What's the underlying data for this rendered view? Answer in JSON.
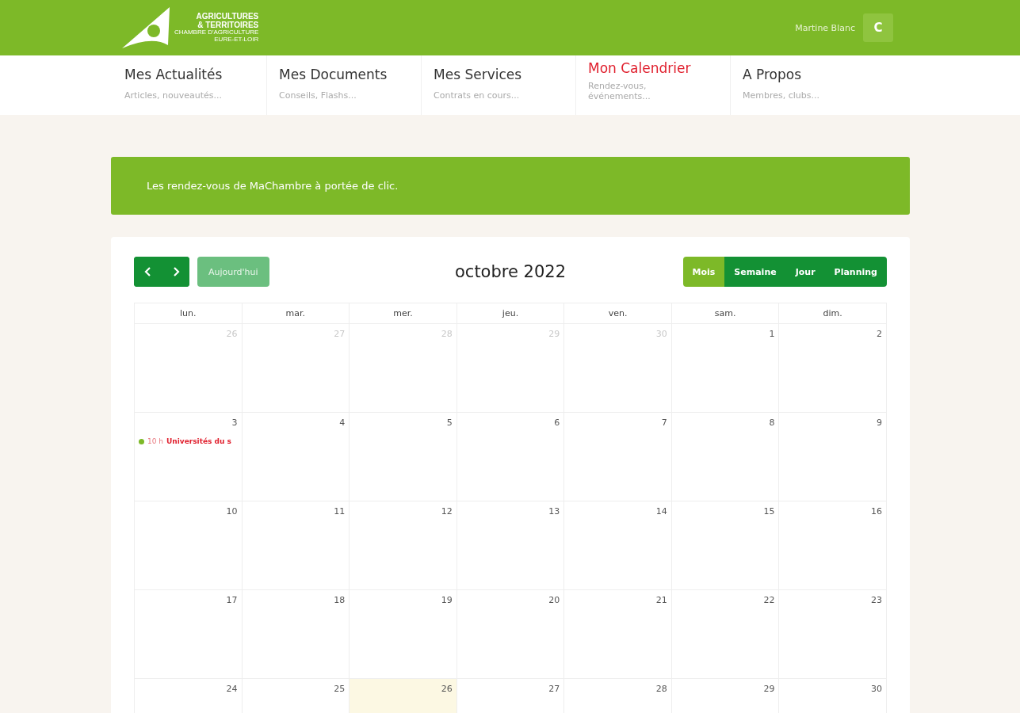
{
  "header": {
    "logo": {
      "line_1": "AGRICULTURES",
      "line_2": "& TERRITOIRES",
      "line_3": "CHAMBRE D'AGRICULTURE",
      "line_4": "EURE-ET-LOIR"
    },
    "user_name": "Martine Blanc",
    "avatar_initial": "C"
  },
  "nav": [
    {
      "title": "Mes Actualités",
      "subtitle": "Articles, nouveautés...",
      "selected": false
    },
    {
      "title": "Mes Documents",
      "subtitle": "Conseils, Flashs...",
      "selected": false
    },
    {
      "title": "Mes Services",
      "subtitle": "Contrats en cours...",
      "selected": false
    },
    {
      "title": "Mon Calendrier",
      "subtitle": "Rendez-vous, événements...",
      "selected": true
    },
    {
      "title": "A Propos",
      "subtitle": "Membres, clubs...",
      "selected": false
    }
  ],
  "banner": "Les rendez-vous de MaChambre à portée de clic.",
  "calendar": {
    "title": "octobre 2022",
    "today_button": {
      "label": "Aujourd'hui",
      "disabled": true
    },
    "views": [
      {
        "label": "Mois",
        "selected": true
      },
      {
        "label": "Semaine",
        "selected": false
      },
      {
        "label": "Jour",
        "selected": false
      },
      {
        "label": "Planning",
        "selected": false
      }
    ],
    "weekdays": [
      "lun.",
      "mar.",
      "mer.",
      "jeu.",
      "ven.",
      "sam.",
      "dim."
    ],
    "weeks": [
      [
        {
          "day": "26",
          "outside": true,
          "today": false
        },
        {
          "day": "27",
          "outside": true,
          "today": false
        },
        {
          "day": "28",
          "outside": true,
          "today": false
        },
        {
          "day": "29",
          "outside": true,
          "today": false
        },
        {
          "day": "30",
          "outside": true,
          "today": false
        },
        {
          "day": "1",
          "outside": false,
          "today": false
        },
        {
          "day": "2",
          "outside": false,
          "today": false
        }
      ],
      [
        {
          "day": "3",
          "outside": false,
          "today": false,
          "events": [
            {
              "time": "10 h",
              "title": "Universités du s",
              "color": "#7db928"
            }
          ]
        },
        {
          "day": "4",
          "outside": false,
          "today": false
        },
        {
          "day": "5",
          "outside": false,
          "today": false
        },
        {
          "day": "6",
          "outside": false,
          "today": false
        },
        {
          "day": "7",
          "outside": false,
          "today": false
        },
        {
          "day": "8",
          "outside": false,
          "today": false
        },
        {
          "day": "9",
          "outside": false,
          "today": false
        }
      ],
      [
        {
          "day": "10",
          "outside": false,
          "today": false
        },
        {
          "day": "11",
          "outside": false,
          "today": false
        },
        {
          "day": "12",
          "outside": false,
          "today": false
        },
        {
          "day": "13",
          "outside": false,
          "today": false
        },
        {
          "day": "14",
          "outside": false,
          "today": false
        },
        {
          "day": "15",
          "outside": false,
          "today": false
        },
        {
          "day": "16",
          "outside": false,
          "today": false
        }
      ],
      [
        {
          "day": "17",
          "outside": false,
          "today": false
        },
        {
          "day": "18",
          "outside": false,
          "today": false
        },
        {
          "day": "19",
          "outside": false,
          "today": false
        },
        {
          "day": "20",
          "outside": false,
          "today": false
        },
        {
          "day": "21",
          "outside": false,
          "today": false
        },
        {
          "day": "22",
          "outside": false,
          "today": false
        },
        {
          "day": "23",
          "outside": false,
          "today": false
        }
      ],
      [
        {
          "day": "24",
          "outside": false,
          "today": false
        },
        {
          "day": "25",
          "outside": false,
          "today": false
        },
        {
          "day": "26",
          "outside": false,
          "today": true
        },
        {
          "day": "27",
          "outside": false,
          "today": false
        },
        {
          "day": "28",
          "outside": false,
          "today": false
        },
        {
          "day": "29",
          "outside": false,
          "today": false
        },
        {
          "day": "30",
          "outside": false,
          "today": false
        }
      ]
    ]
  }
}
